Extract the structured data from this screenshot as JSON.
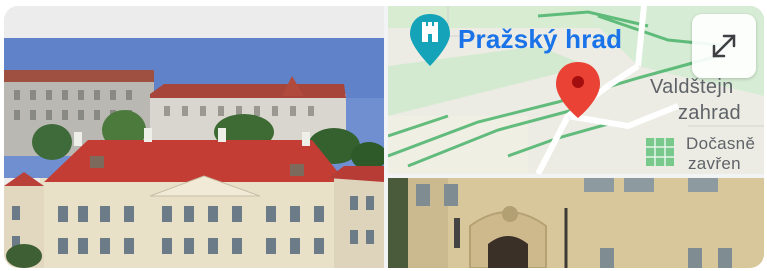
{
  "map": {
    "castle_label": "Pražský hrad",
    "garden_label_line1": "Valdštejn",
    "garden_label_line2": "zahrad",
    "temp_label_line1": "Dočasně",
    "temp_label_line2": "zavřen",
    "accent_color": "#1a73e8",
    "pin_color": "#ea4335"
  },
  "icons": {
    "castle": "castle-pin-icon",
    "pin": "location-pin-icon",
    "expand": "expand-icon"
  }
}
